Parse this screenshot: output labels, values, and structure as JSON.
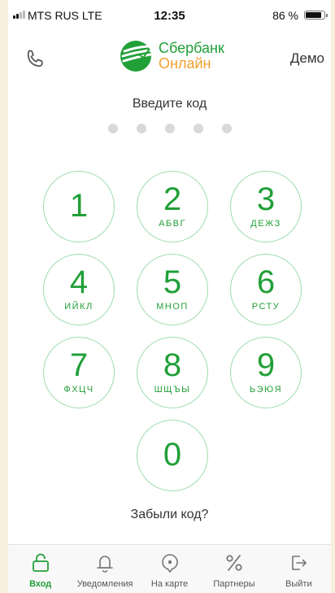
{
  "status_bar": {
    "carrier": "MTS RUS  LTE",
    "time": "12:35",
    "battery_percent": "86 %",
    "battery_level": 0.86
  },
  "header": {
    "logo_line1": "Сбербанк",
    "logo_line2": "Онлайн",
    "demo_label": "Демо",
    "phone_icon": "phone-icon"
  },
  "pin": {
    "title": "Введите код",
    "dots_count_label": "5"
  },
  "keypad": {
    "k1": {
      "digit": "1",
      "letters": ""
    },
    "k2": {
      "digit": "2",
      "letters": "АБВГ"
    },
    "k3": {
      "digit": "3",
      "letters": "ДЕЖЗ"
    },
    "k4": {
      "digit": "4",
      "letters": "ИЙКЛ"
    },
    "k5": {
      "digit": "5",
      "letters": "МНОП"
    },
    "k6": {
      "digit": "6",
      "letters": "РСТУ"
    },
    "k7": {
      "digit": "7",
      "letters": "ФХЦЧ"
    },
    "k8": {
      "digit": "8",
      "letters": "ШЩЪЫ"
    },
    "k9": {
      "digit": "9",
      "letters": "ЬЭЮЯ"
    },
    "k0": {
      "digit": "0",
      "letters": ""
    }
  },
  "forgot_label": "Забыли код?",
  "tabs": [
    {
      "label": "Вход",
      "icon": "unlock-icon",
      "active": true
    },
    {
      "label": "Уведомления",
      "icon": "bell-icon",
      "active": false
    },
    {
      "label": "На карте",
      "icon": "map-pin-icon",
      "active": false
    },
    {
      "label": "Партнеры",
      "icon": "percent-icon",
      "active": false
    },
    {
      "label": "Выйти",
      "icon": "logout-icon",
      "active": false
    }
  ],
  "colors": {
    "brand_green": "#21a038",
    "brand_orange": "#f0a030",
    "key_border": "#9fdcae",
    "dot_inactive": "#d9d9d9",
    "tab_inactive": "#8a8a8a"
  }
}
